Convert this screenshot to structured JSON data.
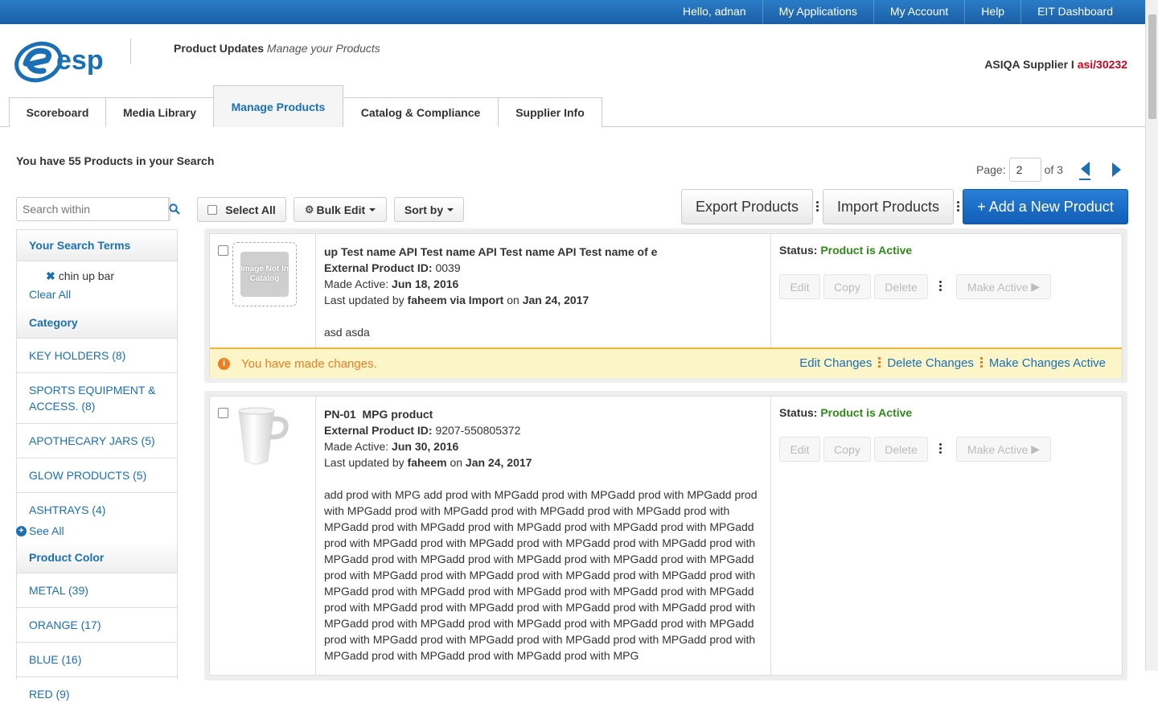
{
  "topnav": {
    "greeting": "Hello, adnan",
    "items": [
      "My Applications",
      "My Account",
      "Help",
      "EIT Dashboard"
    ]
  },
  "header": {
    "app_name": "Product Updates",
    "app_subtitle": "Manage your Products",
    "supplier_name": "ASIQA Supplier",
    "supplier_sep": " I ",
    "supplier_id": "asi/30232"
  },
  "tabs": [
    {
      "label": "Scoreboard"
    },
    {
      "label": "Media Library"
    },
    {
      "label": "Manage Products",
      "active": true
    },
    {
      "label": "Catalog & Compliance"
    },
    {
      "label": "Supplier Info"
    }
  ],
  "results": {
    "text": "You have 55 Products in your Search"
  },
  "pager": {
    "label": "Page:",
    "current": "2",
    "of_text": "of 3"
  },
  "search": {
    "placeholder": "Search within"
  },
  "sidebar": {
    "search_terms_heading": "Your Search Terms",
    "term": "chin up bar",
    "clear_all": "Clear All",
    "category_heading": "Category",
    "categories": [
      {
        "label": "KEY HOLDERS",
        "count": "(8)"
      },
      {
        "label": "SPORTS EQUIPMENT & ACCESS.",
        "count": "(8)"
      },
      {
        "label": "APOTHECARY JARS",
        "count": "(5)"
      },
      {
        "label": "GLOW PRODUCTS",
        "count": "(5)"
      },
      {
        "label": "ASHTRAYS",
        "count": "(4)"
      }
    ],
    "see_all": "See All",
    "color_heading": "Product Color",
    "colors": [
      {
        "label": "METAL",
        "count": "(39)"
      },
      {
        "label": "ORANGE",
        "count": "(17)"
      },
      {
        "label": "BLUE",
        "count": "(16)"
      },
      {
        "label": "RED",
        "count": "(9)"
      }
    ]
  },
  "toolbar": {
    "select_all": "Select All",
    "bulk_edit": "Bulk Edit",
    "sort_by": "Sort by",
    "export": "Export Products",
    "import": "Import Products",
    "add_new": "+ Add a New Product"
  },
  "products": [
    {
      "title": "up Test name API Test name API Test name API Test name of e",
      "ext_id_label": "External Product ID:",
      "ext_id": "0039",
      "made_active_label": "Made Active:",
      "made_active": "Jun 18, 2016",
      "updated_prefix": "Last updated by",
      "updated_by": "faheem via Import",
      "updated_on_word": "on",
      "updated_on": "Jan 24, 2017",
      "description": "asd asda",
      "image_placeholder": "Image Not In Catalog",
      "status_label": "Status:",
      "status": "Product is Active",
      "banner_msg": "You have made changes.",
      "banner_links": [
        "Edit Changes",
        "Delete Changes",
        "Make Changes Active"
      ]
    },
    {
      "title": "PN-01  MPG product",
      "ext_id_label": "External Product ID:",
      "ext_id": "9207-550805372",
      "made_active_label": "Made Active:",
      "made_active": "Jun 30, 2016",
      "updated_prefix": "Last updated by",
      "updated_by": "faheem",
      "updated_on_word": "on",
      "updated_on": "Jan 24, 2017",
      "description": "add prod with MPG add prod with MPGadd prod with MPGadd prod with MPGadd prod with MPGadd prod with MPGadd prod with MPGadd prod with MPGadd prod with MPGadd prod with MPGadd prod with MPGadd prod with MPGadd prod with MPGadd prod with MPGadd prod with MPGadd prod with MPGadd prod with MPGadd prod with MPGadd prod with MPGadd prod with MPGadd prod with MPGadd prod with MPGadd prod with MPGadd prod with MPGadd prod with MPGadd prod with MPGadd prod with MPGadd prod with MPGadd prod with MPGadd prod with MPGadd prod with MPGadd prod with MPGadd prod with MPGadd prod with MPGadd prod with MPGadd prod with MPGadd prod with MPGadd prod with MPGadd prod with MPGadd prod with MPGadd prod with MPGadd prod with MPGadd prod with MPGadd prod with MPGadd prod with MPGadd prod with MPGadd prod with MPGadd prod with MPG",
      "status_label": "Status:",
      "status": "Product is Active"
    }
  ],
  "actions": {
    "edit": "Edit",
    "copy": "Copy",
    "delete": "Delete",
    "make_active": "Make Active"
  },
  "colors": {
    "brand_blue": "#1a6fb5",
    "active_green": "#2e8b1a",
    "warning_orange": "#ef7d22",
    "supplier_red": "#d0021b"
  }
}
